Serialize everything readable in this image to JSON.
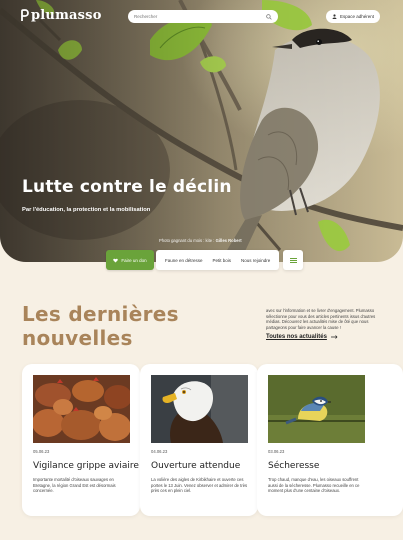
{
  "header": {
    "logo": "plumasso",
    "search_placeholder": "Rechercher",
    "account_label": "Espace adhérent"
  },
  "hero": {
    "title": "Lutte contre le déclin",
    "subtitle": "Par l'éducation, la protection et la mobilisation",
    "credit_prefix": "Photo gagnant du mois : kite :",
    "credit_author": "Gilles Robert"
  },
  "tabs": {
    "primary_label": "Faire un don",
    "items": [
      "Faune en détresse",
      "Petit bois",
      "Nous rejoindre"
    ]
  },
  "news": {
    "title_line1": "Les dernières",
    "title_line2": "nouvelles",
    "description": "avec sur l'information et se livrer d'engagement. Plumasso sélectionne pour vous des articles pertinents issus d'autres médias. Découvrez les actualités mise de ôté que nous partageons pour faire avancer la cause !",
    "link_label": "Toutes nos actualités"
  },
  "cards": [
    {
      "date": "05.06.23",
      "title": "Vigilance grippe aviaire",
      "text": "Importante mortalité d'oiseaux sauvages en Bretagne, la région Grand Est est désormais concernée.",
      "image": "hens-photo"
    },
    {
      "date": "04.06.23",
      "title": "Ouverture attendue",
      "text": "La volière des aigles de Kirbikhaire et ouverte ces portes le 13 Juin. Venez observer et admirer de très près ces en plein ciel.",
      "image": "eagle-photo"
    },
    {
      "date": "03.06.23",
      "title": "Sécheresse",
      "text": "Trop chaud, manque d'eau, les oiseaux souffrent aussi de la sécheresse. Plumasso recueille en ce moment plus d'une centaine d'oiseaux.",
      "image": "tit-photo"
    }
  ],
  "colors": {
    "accent_green": "#6aa33a",
    "title_brown": "#a9845a",
    "background": "#f7f0e4"
  }
}
